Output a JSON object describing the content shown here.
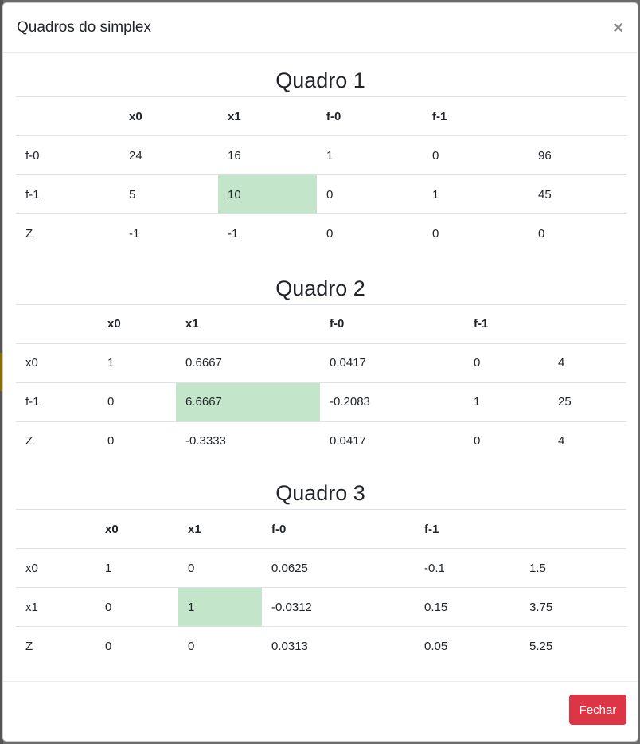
{
  "modal": {
    "title": "Quadros do simplex",
    "close_symbol": "×",
    "close_label": "Fechar"
  },
  "tables": [
    {
      "title": "Quadro 1",
      "headers": [
        "",
        "x0",
        "x1",
        "f-0",
        "f-1",
        ""
      ],
      "rows": [
        [
          "f-0",
          "24",
          "16",
          "1",
          "0",
          "96"
        ],
        [
          "f-1",
          "5",
          "10",
          "0",
          "1",
          "45"
        ],
        [
          "Z",
          "-1",
          "-1",
          "0",
          "0",
          "0"
        ]
      ],
      "pivot": {
        "row": 1,
        "col": 2
      }
    },
    {
      "title": "Quadro 2",
      "headers": [
        "",
        "x0",
        "x1",
        "f-0",
        "f-1",
        ""
      ],
      "rows": [
        [
          "x0",
          "1",
          "0.6667",
          "0.0417",
          "0",
          "4"
        ],
        [
          "f-1",
          "0",
          "6.6667",
          "-0.2083",
          "1",
          "25"
        ],
        [
          "Z",
          "0",
          "-0.3333",
          "0.0417",
          "0",
          "4"
        ]
      ],
      "pivot": {
        "row": 1,
        "col": 2
      }
    },
    {
      "title": "Quadro 3",
      "headers": [
        "",
        "x0",
        "x1",
        "f-0",
        "f-1",
        ""
      ],
      "rows": [
        [
          "x0",
          "1",
          "0",
          "0.0625",
          "-0.1",
          "1.5"
        ],
        [
          "x1",
          "0",
          "1",
          "-0.0312",
          "0.15",
          "3.75"
        ],
        [
          "Z",
          "0",
          "0",
          "0.0313",
          "0.05",
          "5.25"
        ]
      ],
      "pivot": {
        "row": 1,
        "col": 2
      }
    }
  ],
  "colors": {
    "pivot_highlight": "#c3e6cb",
    "danger_button": "#dc3545"
  }
}
